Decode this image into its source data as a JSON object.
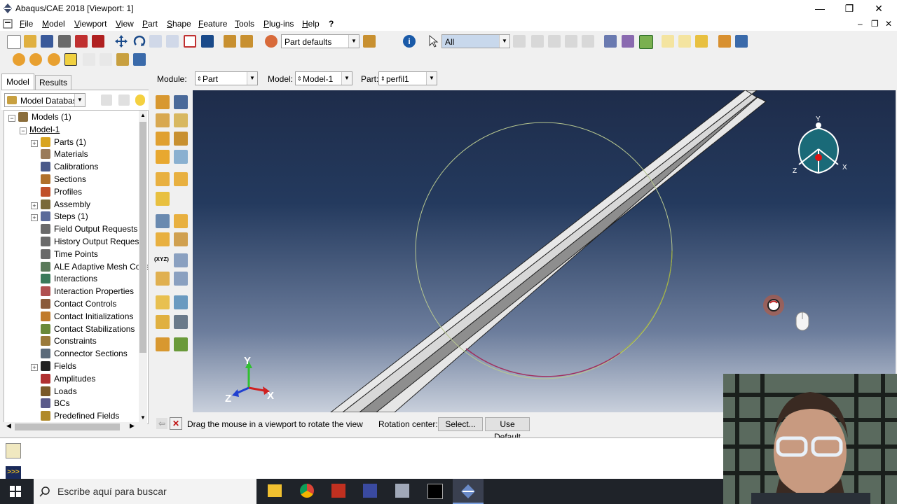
{
  "window": {
    "title": "Abaqus/CAE 2018 [Viewport: 1]",
    "minimize": "—",
    "restore": "❐",
    "close": "✕"
  },
  "menu": [
    "File",
    "Model",
    "Viewport",
    "View",
    "Part",
    "Shape",
    "Feature",
    "Tools",
    "Plug-ins",
    "Help",
    "?"
  ],
  "toolbar": {
    "part_defaults": "Part defaults",
    "selection_filter": "All",
    "info_icon": "i"
  },
  "context": {
    "module_label": "Module:",
    "module_value": "Part",
    "model_label": "Model:",
    "model_value": "Model-1",
    "part_label": "Part:",
    "part_value": "perfil1"
  },
  "tabs": {
    "model": "Model",
    "results": "Results"
  },
  "tree_header": {
    "database": "Model Database"
  },
  "tree": [
    {
      "label": "Models (1)",
      "expand": "−",
      "icon": "models-icon",
      "color": "#8a6d3b"
    },
    {
      "label": "Model-1",
      "expand": "−",
      "icon": "",
      "color": ""
    },
    {
      "label": "Parts (1)",
      "expand": "+",
      "icon": "parts-icon",
      "color": "#d9a520"
    },
    {
      "label": "Materials",
      "expand": "",
      "icon": "materials-icon",
      "color": "#9a7b5a"
    },
    {
      "label": "Calibrations",
      "expand": "",
      "icon": "calibrations-icon",
      "color": "#4a5a8a"
    },
    {
      "label": "Sections",
      "expand": "",
      "icon": "sections-icon",
      "color": "#b0702a"
    },
    {
      "label": "Profiles",
      "expand": "",
      "icon": "profiles-icon",
      "color": "#c0502a"
    },
    {
      "label": "Assembly",
      "expand": "+",
      "icon": "assembly-icon",
      "color": "#7a6a3a"
    },
    {
      "label": "Steps (1)",
      "expand": "+",
      "icon": "steps-icon",
      "color": "#5a6a9a"
    },
    {
      "label": "Field Output Requests",
      "expand": "",
      "icon": "field-output-icon",
      "color": "#6a6a6a"
    },
    {
      "label": "History Output Requests",
      "expand": "",
      "icon": "history-output-icon",
      "color": "#6a6a6a"
    },
    {
      "label": "Time Points",
      "expand": "",
      "icon": "time-points-icon",
      "color": "#6a6a6a"
    },
    {
      "label": "ALE Adaptive Mesh Cons",
      "expand": "",
      "icon": "ale-mesh-icon",
      "color": "#5a7a5a"
    },
    {
      "label": "Interactions",
      "expand": "",
      "icon": "interactions-icon",
      "color": "#3a7a5a"
    },
    {
      "label": "Interaction Properties",
      "expand": "",
      "icon": "interaction-properties-icon",
      "color": "#b05050"
    },
    {
      "label": "Contact Controls",
      "expand": "",
      "icon": "contact-controls-icon",
      "color": "#8a5a3a"
    },
    {
      "label": "Contact Initializations",
      "expand": "",
      "icon": "contact-init-icon",
      "color": "#c07a2a"
    },
    {
      "label": "Contact Stabilizations",
      "expand": "",
      "icon": "contact-stab-icon",
      "color": "#6a8a3a"
    },
    {
      "label": "Constraints",
      "expand": "",
      "icon": "constraints-icon",
      "color": "#9a7a3a"
    },
    {
      "label": "Connector Sections",
      "expand": "",
      "icon": "connector-sections-icon",
      "color": "#5a6a7a"
    },
    {
      "label": "Fields",
      "expand": "+",
      "icon": "fields-icon",
      "color": "#222222"
    },
    {
      "label": "Amplitudes",
      "expand": "",
      "icon": "amplitudes-icon",
      "color": "#b03030"
    },
    {
      "label": "Loads",
      "expand": "",
      "icon": "loads-icon",
      "color": "#7a5a2a"
    },
    {
      "label": "BCs",
      "expand": "",
      "icon": "bcs-icon",
      "color": "#5a5a8a"
    },
    {
      "label": "Predefined Fields",
      "expand": "",
      "icon": "predefined-fields-icon",
      "color": "#b08a2a"
    }
  ],
  "prompt": {
    "message": "Drag the mouse in a viewport to rotate the view",
    "rotation_label": "Rotation center:",
    "select_btn": "Select...",
    "default_btn": "Use Default"
  },
  "triad": {
    "y": "Y",
    "x": "X",
    "z": "Z"
  },
  "view_cube": {
    "y": "Y",
    "x": "X",
    "z": "Z"
  },
  "taskbar": {
    "search_placeholder": "Escribe aquí para buscar"
  },
  "colors": {
    "accent": "#0078d7",
    "viewport_top": "#1e2c4a",
    "viewport_bottom": "#c9d0dc"
  }
}
